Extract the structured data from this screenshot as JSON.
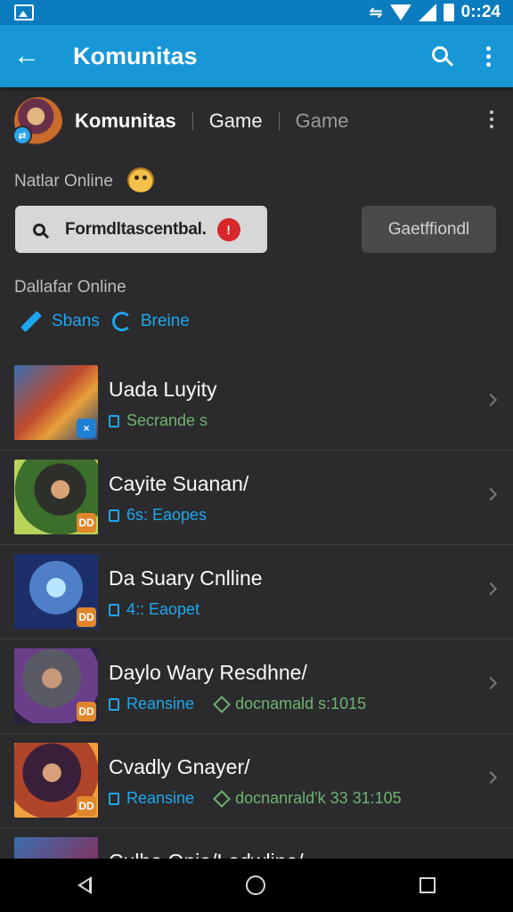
{
  "status_bar": {
    "time": "0::24",
    "icons": [
      "gallery-icon",
      "vibrate-icon",
      "wifi-icon",
      "signal-icon",
      "battery-icon"
    ]
  },
  "app_bar": {
    "back_icon": "arrow-left-icon",
    "title": "Komunitas",
    "search_icon": "search-icon",
    "menu_icon": "more-vert-icon",
    "color": "#1797d6"
  },
  "community": {
    "title": "Komunitas",
    "tab1": "Game",
    "tab2": "Game",
    "more_icon": "more-vert-icon"
  },
  "online_label": "Natlar Online",
  "search": {
    "text": "Formdltascentbal.",
    "badge": "!"
  },
  "get_button": "Gaetffiondl",
  "dallafar_label": "Dallafar Online",
  "filters": [
    {
      "label": "Sbans",
      "icon": "pencil-icon"
    },
    {
      "label": "Breine",
      "icon": "refresh-icon"
    }
  ],
  "items": [
    {
      "title": "Uada Luyity",
      "sub1": "Secrande s",
      "sub1_color": "#6fb36f",
      "sub2": "",
      "badge": "×",
      "badge_color": "#1f7fd0"
    },
    {
      "title": "Cayite Suanan/",
      "sub1": "6s: Eaopes",
      "sub1_color": "#1ea6ec",
      "sub2": "",
      "badge": "DD",
      "badge_color": "#e0872a"
    },
    {
      "title": "Da Suary Cnlline",
      "sub1": "4:: Eaopet",
      "sub1_color": "#1ea6ec",
      "sub2": "",
      "badge": "DD",
      "badge_color": "#e0872a"
    },
    {
      "title": "Daylo Wary Resdhne/",
      "sub1": "Reansine",
      "sub1_color": "#1ea6ec",
      "sub2": "docnamald s:1015",
      "badge": "DD",
      "badge_color": "#e0872a"
    },
    {
      "title": "Cvadly Gnayer/",
      "sub1": "Reansine",
      "sub1_color": "#1ea6ec",
      "sub2": "docnanrald'k 33 31:105",
      "badge": "DD",
      "badge_color": "#e0872a"
    },
    {
      "title": "Culbo Onia/Lodwline/",
      "sub1": "",
      "sub1_color": "#1ea6ec",
      "sub2": "",
      "badge": "",
      "badge_color": "#e0872a"
    }
  ],
  "nav_bar": {
    "icons": [
      "nav-back-icon",
      "nav-home-icon",
      "nav-recent-icon"
    ]
  }
}
